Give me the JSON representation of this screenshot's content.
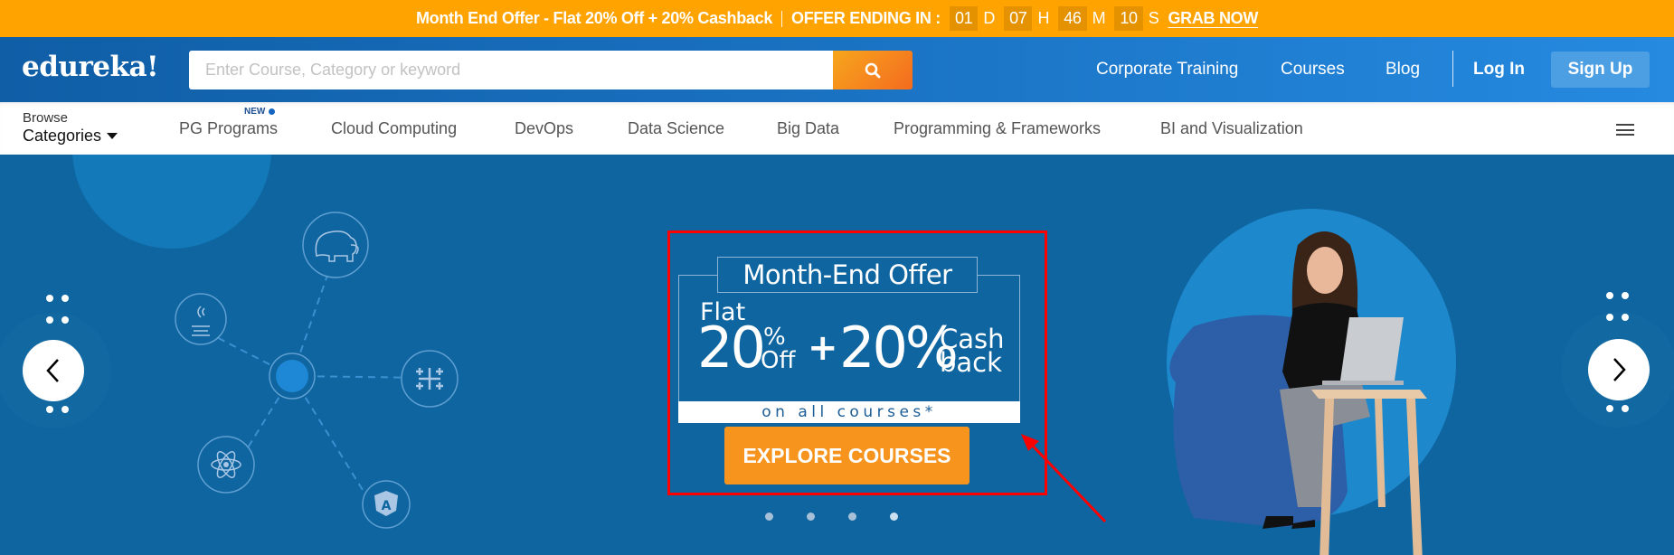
{
  "offer_bar": {
    "headline": "Month End Offer - Flat 20% Off + 20% Cashback",
    "ending_label": "OFFER ENDING IN :",
    "countdown": [
      {
        "value": "01",
        "unit": "D"
      },
      {
        "value": "07",
        "unit": "H"
      },
      {
        "value": "46",
        "unit": "M"
      },
      {
        "value": "10",
        "unit": "S"
      }
    ],
    "cta": "GRAB NOW"
  },
  "header": {
    "logo": "edureka!",
    "search": {
      "placeholder": "Enter Course, Category or keyword",
      "value": ""
    },
    "search_icon": "search-icon",
    "nav": [
      "Corporate Training",
      "Courses",
      "Blog"
    ],
    "login": "Log In",
    "signup": "Sign Up"
  },
  "category_nav": {
    "browse_top": "Browse",
    "browse_bottom": "Categories",
    "new_badge": "NEW",
    "items": [
      "PG Programs",
      "Cloud Computing",
      "DevOps",
      "Data Science",
      "Big Data",
      "Programming & Frameworks",
      "BI and Visualization"
    ],
    "menu_icon": "hamburger-icon"
  },
  "hero": {
    "promo": {
      "title": "Month-End Offer",
      "flat": "Flat",
      "off_value": "20",
      "off_pct": "%",
      "off_label": "Off",
      "plus": "+",
      "cashback_value": "20%",
      "cashback_label_1": "Cash",
      "cashback_label_2": "back",
      "subtitle": "on all courses*",
      "cta": "EXPLORE COURSES"
    },
    "slides_total": 4,
    "active_slide": 4,
    "tech_icons": [
      "hadoop-icon",
      "java-icon",
      "tableau-icon",
      "react-icon",
      "angular-icon"
    ],
    "colors": {
      "annotation": "#ff0000",
      "cta": "#f7941d",
      "background": "#0e65a0"
    }
  }
}
